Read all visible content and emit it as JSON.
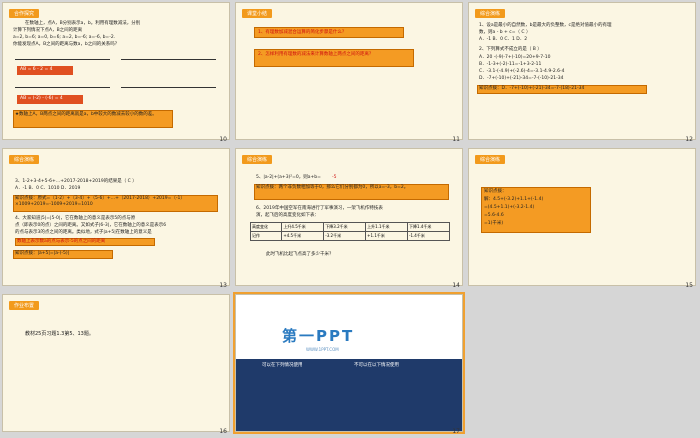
{
  "slides": [
    {
      "num": "10",
      "tag": "合作探究",
      "lines": [
        "在数轴上，点A，B分别表示a，b。利用有理数减法，分别",
        "计算下列情况下点A，B之间的距离",
        "a=2, b=6; a=0, b=6; a=2, b=-6; a=-6, b=-2.",
        "你能发现点A，B之间的距离与数a，b之间的关系吗？"
      ],
      "eqs": [
        "AB = 6 - 2 = 4",
        "AB = (-2) - (-6) = 4"
      ],
      "answer": "★数轴上A，B两点之间的距离就是a，b中较大的数减去较小的数的差。"
    },
    {
      "num": "11",
      "tag": "课堂小结",
      "items": [
        "1、有理数加减混合运算的简化步骤是什么？",
        "2、怎样利用有理数的减法来计算数轴上两点之间的距离？"
      ]
    },
    {
      "num": "12",
      "tag": "综合演练",
      "lines": [
        "1、设a是最小的自然数，b是最大的负整数，c是绝对值最小的有理",
        "数，则a - b + c=（ C ）",
        "A．-1   B．0   C．1   D．2",
        "2、下列算式不成立的是（ B ）",
        "A．20 -(-9)-7+(-10)=20+9-7-10",
        "B．-1-3+(-2)-11=-1+3-2-11",
        "C．-3.1-(-4.9)+(-2.6)-4=-3.1-4.9-2.6-4",
        "D．-7+(-10)+(-21)-34=-7-(-10)-21-34"
      ],
      "tip": "知识点拨：D．-7+(-10)+(-21)-34=-7-(18)-21-34"
    },
    {
      "num": "13",
      "tag": "综合演练",
      "lines": [
        "3、1-2+3-4+5-6+…+2017-2018+2019的结果是（ C ）",
        "A．-1     B．0     C．1010     D．2019"
      ],
      "tip": "知识点拨：原式=（1-2）+（3-4）+（5-6）+…+（2017-2018）+2019=（-1）×1009+2019=-1009+2019=1010",
      "q4": [
        "4、大家知道|5|=|5-0|，它在数轴上的意义是表示5的点与原",
        "点（即表示0的点）之间的距离。又如式子|6-3|，它在数轴上的意义是表示6",
        "的点与表示3的点之间的距离。类似地，式子|a+5|在数轴上的意义是"
      ],
      "ans4": "数轴上表示数a的点与表示-5的点之间的距离",
      "tip2": "知识点拨：|a+5|=|a-(-5)|"
    },
    {
      "num": "14",
      "tag": "综合演练",
      "l5": "5、|a-2|+(a+3)²=0，则a+b=",
      "l5ans": "-5",
      "tip": "知识点拨：两个非负数相加等于0，那么它们分别都为0，所以a=-3，b=2。",
      "l6a": "6、2019年中国空军在南海进行了军事演习，一架飞机作特技表",
      "l6b": "演，起飞后的高度变化如下表：",
      "th": [
        "高度变化",
        "上升4.5千米",
        "下降3.2千米",
        "上升1.1千米",
        "下降1.4千米"
      ],
      "tr": [
        "记作",
        "+4.5千米",
        "-3.2千米",
        "+1.1千米",
        "-1.4千米"
      ],
      "q": "此时飞机比起飞点高了多少千米？"
    },
    {
      "num": "15",
      "tag": "综合演练",
      "tip": [
        "知识点拨：",
        "解：4.5+(-3.2)+1.1+(-1.4)",
        "=(4.5+1.1)+(-3.2-1.4)",
        "=5.6-4.6",
        "=1(千米)"
      ]
    },
    {
      "num": "16",
      "tag": "作业布置",
      "hw": "教材25页习题1.3第5、13题。"
    },
    {
      "num": "17",
      "logo": "第一PPT",
      "logo_sub": "WWW.1PPT.COM",
      "col1": "可以在下列情况使用",
      "col2": "不可以在以下情况使用"
    }
  ]
}
